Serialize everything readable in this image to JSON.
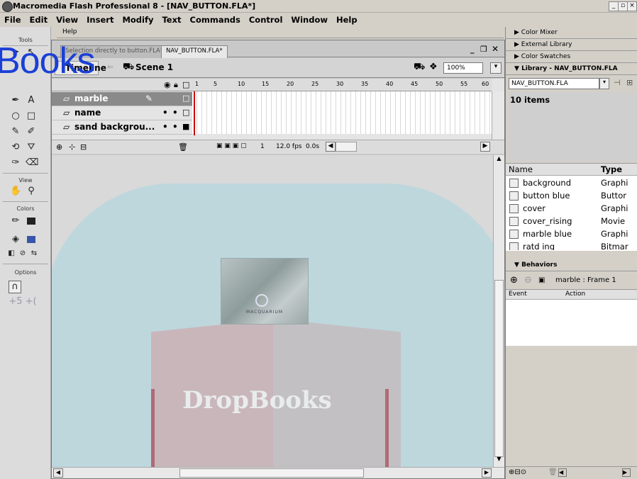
{
  "window": {
    "title": "Macromedia Flash Professional 8 - [NAV_BUTTON.FLA*]"
  },
  "menu": [
    "File",
    "Edit",
    "View",
    "Insert",
    "Modify",
    "Text",
    "Commands",
    "Control",
    "Window",
    "Help"
  ],
  "tools": {
    "header": "Tools",
    "view_label": "View",
    "colors_label": "Colors",
    "options_label": "Options"
  },
  "help_bar": {
    "label": "Help"
  },
  "document": {
    "tabs": [
      "Selection directly to button.FLA*",
      "NAV_BUTTON.FLA*"
    ],
    "active_tab": 1,
    "timeline_button": "Timeline",
    "scene": "Scene 1",
    "zoom": "100%",
    "layers": [
      {
        "name": "marble",
        "selected": true
      },
      {
        "name": "name",
        "selected": false
      },
      {
        "name": "sand backgrou...",
        "selected": false
      }
    ],
    "frame_numbers": [
      "1",
      "5",
      "10",
      "15",
      "20",
      "25",
      "30",
      "35",
      "40",
      "45",
      "50",
      "55",
      "60"
    ],
    "status": {
      "frame": "1",
      "fps": "12.0 fps",
      "time": "0.0s"
    },
    "stage_logo_text": "MACQUARIUM",
    "cover_text": "DropBooks"
  },
  "watermark": {
    "text": "Books"
  },
  "panels": {
    "color_mixer": "Color Mixer",
    "external_library": "External Library",
    "color_swatches": "Color Swatches",
    "library_title": "Library - NAV_BUTTON.FLA",
    "library_file": "NAV_BUTTON.FLA",
    "item_count": "10 items",
    "columns": {
      "name": "Name",
      "type": "Type"
    },
    "items": [
      {
        "name": "background",
        "type": "Graphi"
      },
      {
        "name": "button blue",
        "type": "Buttor"
      },
      {
        "name": "cover",
        "type": "Graphi"
      },
      {
        "name": "cover_rising",
        "type": "Movie"
      },
      {
        "name": "marble blue",
        "type": "Graphi"
      },
      {
        "name": "ratd ing",
        "type": "Bitmar"
      }
    ],
    "behaviors_title": "Behaviors",
    "behaviors_target": "marble : Frame 1",
    "behaviors_columns": {
      "event": "Event",
      "action": "Action"
    }
  }
}
